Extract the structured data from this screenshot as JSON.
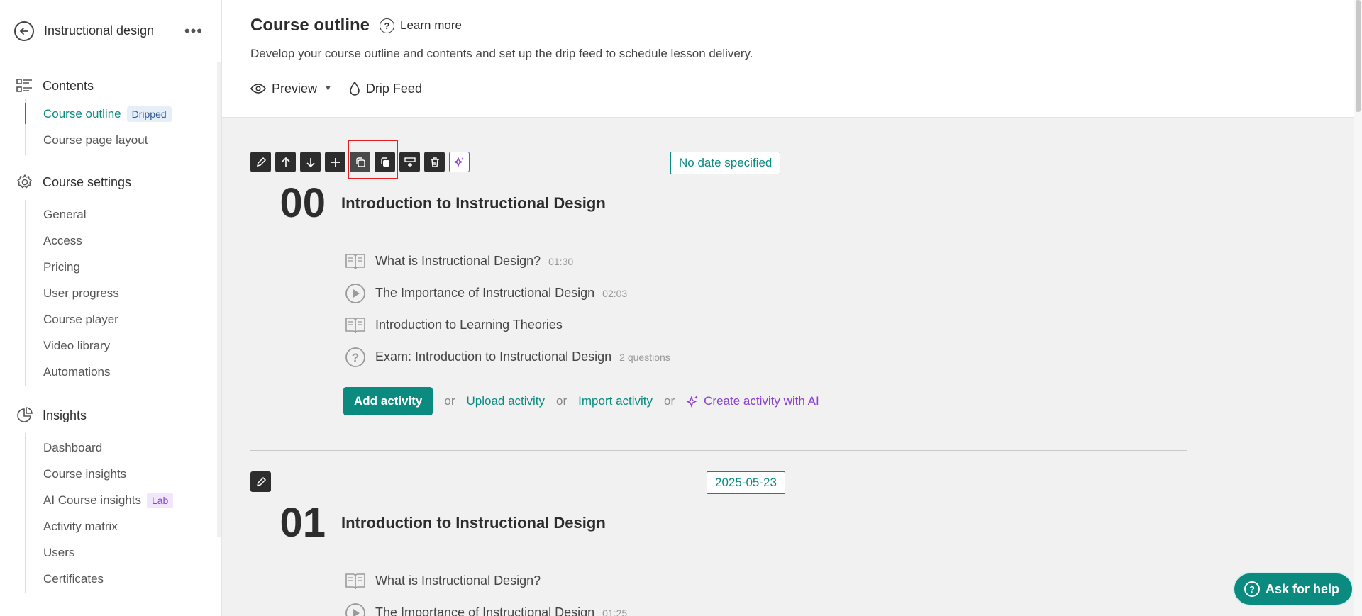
{
  "sidebar": {
    "title": "Instructional design",
    "more": "•••",
    "sections": [
      {
        "label": "Contents"
      },
      {
        "label": "Course settings"
      },
      {
        "label": "Insights"
      }
    ],
    "contents_items": [
      {
        "label": "Course outline",
        "badge": "Dripped"
      },
      {
        "label": "Course page layout"
      }
    ],
    "settings_items": [
      "General",
      "Access",
      "Pricing",
      "User progress",
      "Course player",
      "Video library",
      "Automations"
    ],
    "insights_items": [
      {
        "label": "Dashboard"
      },
      {
        "label": "Course insights"
      },
      {
        "label": "AI Course insights",
        "badge": "Lab"
      },
      {
        "label": "Activity matrix"
      },
      {
        "label": "Users"
      },
      {
        "label": "Certificates"
      }
    ]
  },
  "header": {
    "title": "Course outline",
    "learn_more": "Learn more",
    "subtitle": "Develop your course outline and contents and set up the drip feed to schedule lesson delivery.",
    "preview": "Preview",
    "drip_feed": "Drip Feed"
  },
  "sections": [
    {
      "number": "00",
      "title": "Introduction to Instructional Design",
      "date": "No date specified",
      "lessons": [
        {
          "title": "What is Instructional Design?",
          "meta": "01:30",
          "icon": "book-icon"
        },
        {
          "title": "The Importance of Instructional Design",
          "meta": "02:03",
          "icon": "play-icon"
        },
        {
          "title": "Introduction to Learning Theories",
          "meta": "",
          "icon": "book-icon"
        },
        {
          "title": "Exam: Introduction to Instructional Design",
          "meta": "2 questions",
          "icon": "question-icon"
        }
      ],
      "add_activity": "Add activity",
      "or": "or",
      "upload_activity": "Upload activity",
      "import_activity": "Import activity",
      "create_ai": "Create activity with AI"
    },
    {
      "number": "01",
      "title": "Introduction to Instructional Design",
      "date": "2025-05-23",
      "lessons": [
        {
          "title": "What is Instructional Design?",
          "meta": "",
          "icon": "book-icon"
        },
        {
          "title": "The Importance of Instructional Design",
          "meta": "01:25",
          "icon": "play-icon"
        }
      ]
    }
  ],
  "help": "Ask for help",
  "colors": {
    "accent": "#0b8a80",
    "ai": "#8a3fcf",
    "highlight": "#e02020"
  }
}
